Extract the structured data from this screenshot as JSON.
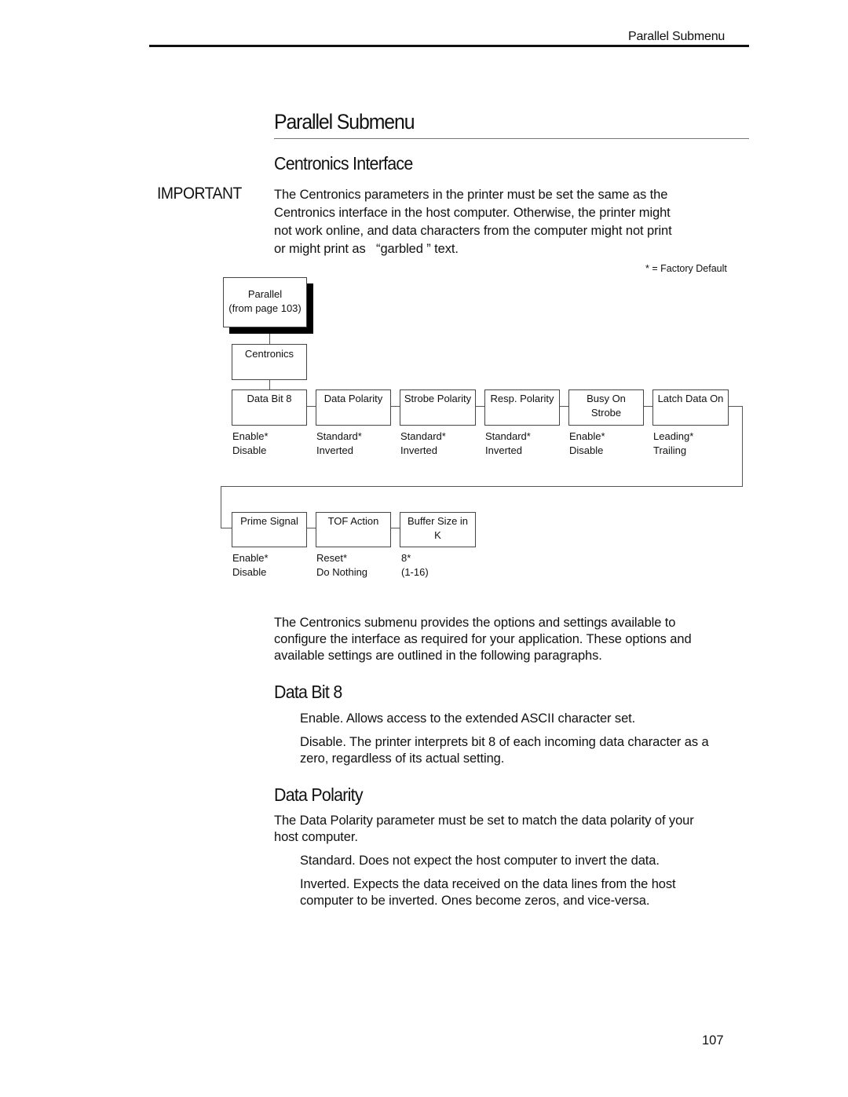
{
  "header": {
    "running_title": "Parallel Submenu"
  },
  "page_title": "Parallel Submenu",
  "section_title": "Centronics Interface",
  "important": {
    "label": "IMPORTANT",
    "line1": "The Centronics parameters in the printer must be set the same as the",
    "line2": "Centronics interface in the host computer. Otherwise, the printer might",
    "line3": "not work online, and data characters from the computer might not print",
    "line4": "or might print as   “garbled ” text."
  },
  "legend_note": "* = Factory Default",
  "diagram": {
    "root": {
      "line1": "Parallel",
      "line2": "(from page 103)"
    },
    "submenu": "Centronics",
    "row1": [
      {
        "label1": "Data Bit 8",
        "label2": "",
        "options": [
          "Enable*",
          "Disable"
        ]
      },
      {
        "label1": "Data Polarity",
        "label2": "",
        "options": [
          "Standard*",
          "Inverted"
        ]
      },
      {
        "label1": "Strobe Polarity",
        "label2": "",
        "options": [
          "Standard*",
          "Inverted"
        ]
      },
      {
        "label1": "Resp. Polarity",
        "label2": "",
        "options": [
          "Standard*",
          "Inverted"
        ]
      },
      {
        "label1": "Busy On",
        "label2": "Strobe",
        "options": [
          "Enable*",
          "Disable"
        ]
      },
      {
        "label1": "Latch Data On",
        "label2": "",
        "options": [
          "Leading*",
          "Trailing"
        ]
      }
    ],
    "row2": [
      {
        "label1": "Prime Signal",
        "label2": "",
        "options": [
          "Enable*",
          "Disable"
        ]
      },
      {
        "label1": "TOF Action",
        "label2": "",
        "options": [
          "Reset*",
          "Do Nothing"
        ]
      },
      {
        "label1": "Buffer Size in",
        "label2": "K",
        "options": [
          "8*",
          "(1-16)"
        ]
      }
    ]
  },
  "intro": {
    "line1": "The Centronics submenu provides the options and settings available to",
    "line2": "configure the interface as required for your application. These options and",
    "line3": "available settings are outlined in the following paragraphs."
  },
  "data_bit_8": {
    "heading": "Data Bit 8",
    "enable": "Enable.  Allows access to the extended ASCII character set.",
    "disable_line1": "Disable.  The printer interprets bit 8 of each incoming data character as a",
    "disable_line2": "zero, regardless of its actual setting."
  },
  "data_polarity": {
    "heading": "Data Polarity",
    "intro_line1": "The Data Polarity parameter must be set to match the data polarity of your",
    "intro_line2": "host computer.",
    "standard": "Standard.  Does not expect the host computer to invert the data.",
    "inverted_line1": "Inverted.  Expects the data received on the data lines from the host",
    "inverted_line2": "computer to be inverted. Ones become zeros, and vice-versa."
  },
  "page_number": "107"
}
